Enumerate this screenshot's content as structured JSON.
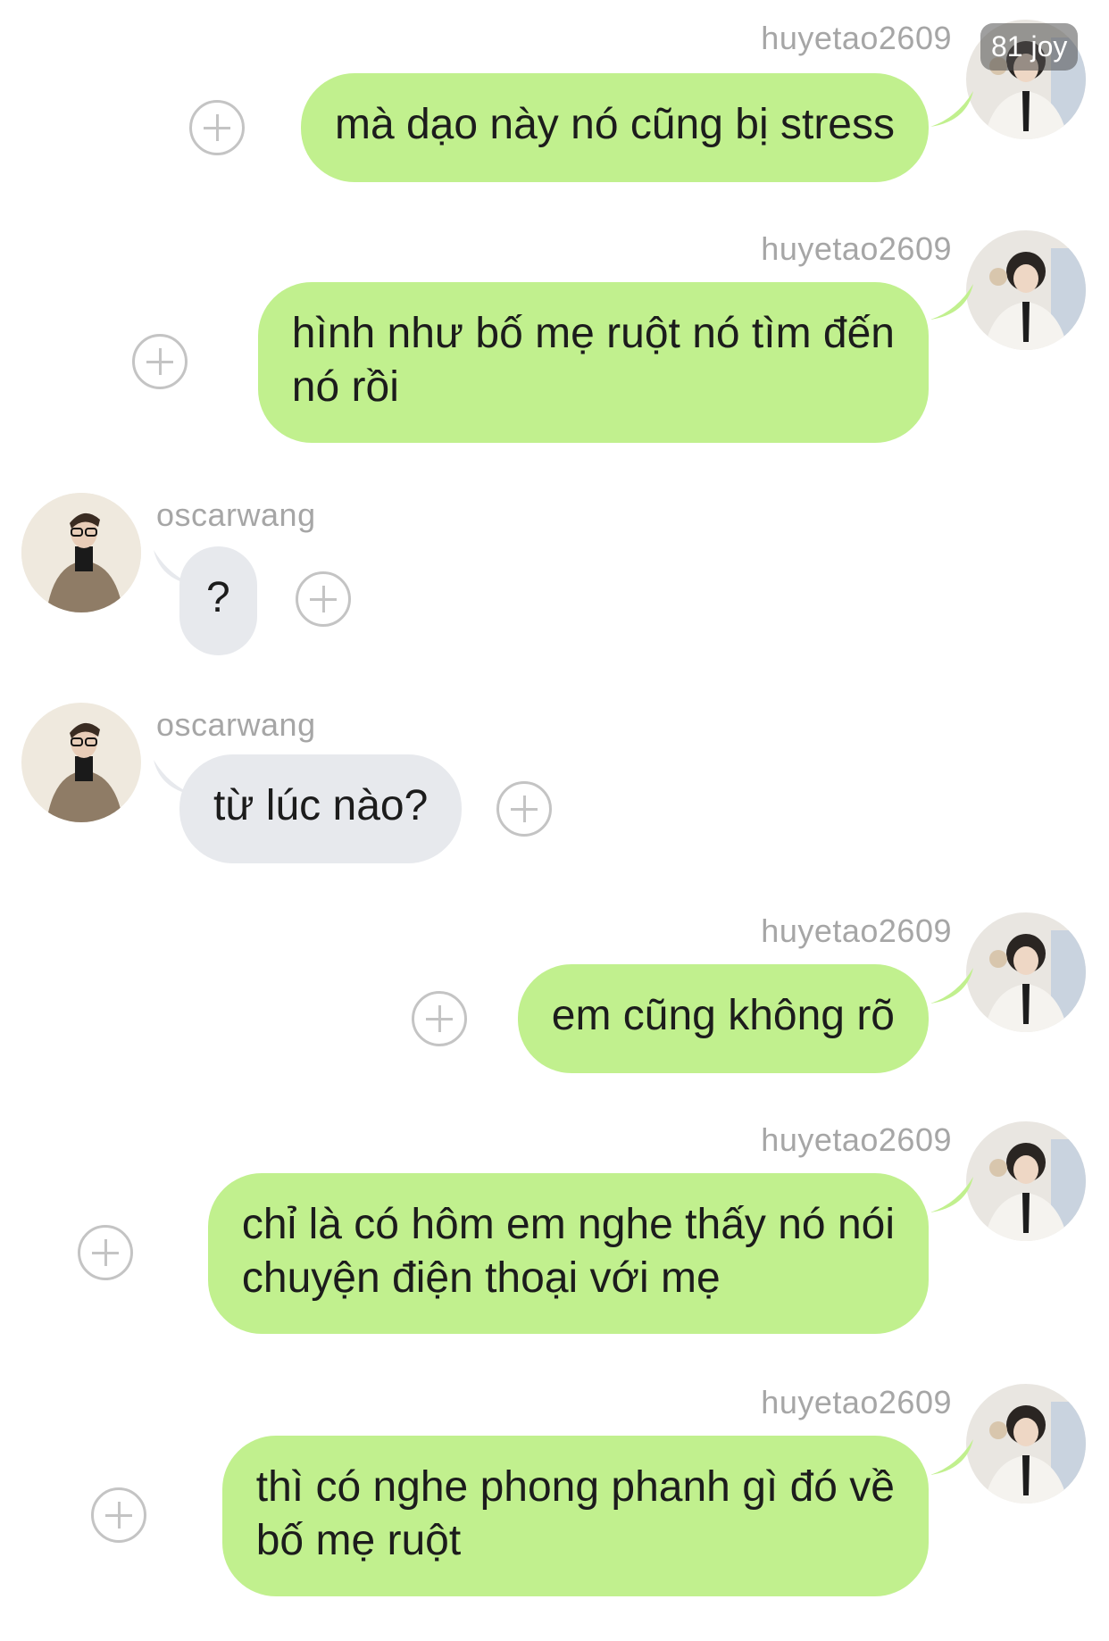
{
  "badge": "81 joy",
  "users": {
    "me": "huyetao2609",
    "other": "oscarwang"
  },
  "messages": [
    {
      "sender": "huyetao2609",
      "lines": [
        "mà dạo này nó cũng bị stress"
      ]
    },
    {
      "sender": "huyetao2609",
      "lines": [
        "hình như bố mẹ ruột nó tìm đến",
        "nó rồi"
      ]
    },
    {
      "sender": "oscarwang",
      "lines": [
        "?"
      ]
    },
    {
      "sender": "oscarwang",
      "lines": [
        "từ lúc nào?"
      ]
    },
    {
      "sender": "huyetao2609",
      "lines": [
        "em cũng không rõ"
      ]
    },
    {
      "sender": "huyetao2609",
      "lines": [
        "chỉ là có hôm em nghe thấy nó nói",
        "chuyện điện thoại với mẹ"
      ]
    },
    {
      "sender": "huyetao2609",
      "lines": [
        "thì có nghe phong phanh gì đó về",
        "bố mẹ ruột"
      ]
    }
  ],
  "colors": {
    "outgoing_bubble": "#c1f08e",
    "incoming_bubble": "#e7e9ed",
    "username": "#a6a6a6"
  }
}
